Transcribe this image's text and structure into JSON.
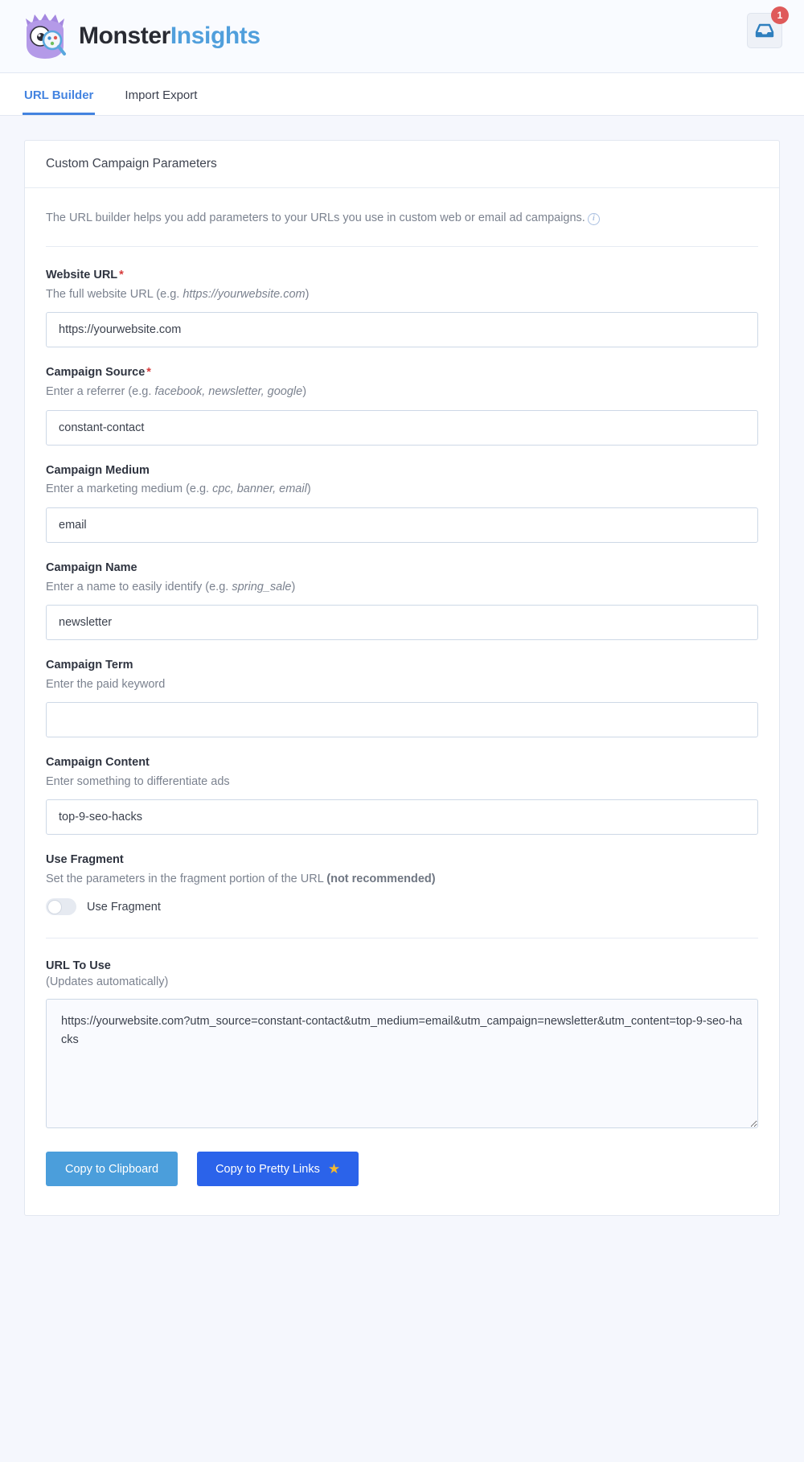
{
  "header": {
    "brand_first": "Monster",
    "brand_second": "Insights",
    "logo_icon": "monster-logo-icon",
    "inbox_icon": "inbox-tray-icon",
    "inbox_badge_count": "1"
  },
  "tabs": [
    {
      "label": "URL Builder",
      "active": true
    },
    {
      "label": "Import Export",
      "active": false
    }
  ],
  "card": {
    "title": "Custom Campaign Parameters",
    "intro": "The URL builder helps you add parameters to your URLs you use in custom web or email ad campaigns.",
    "info_icon": "info-circle-icon",
    "info_glyph": "i"
  },
  "fields": [
    {
      "label": "Website URL",
      "required": true,
      "required_mark": "*",
      "help_prefix": "The full website URL (e.g. ",
      "help_em": "https://yourwebsite.com",
      "help_suffix": ")",
      "value": "https://yourwebsite.com",
      "placeholder": ""
    },
    {
      "label": "Campaign Source",
      "required": true,
      "required_mark": "*",
      "help_prefix": "Enter a referrer (e.g. ",
      "help_em": "facebook, newsletter, google",
      "help_suffix": ")",
      "value": "constant-contact",
      "placeholder": ""
    },
    {
      "label": "Campaign Medium",
      "required": false,
      "required_mark": "",
      "help_prefix": "Enter a marketing medium (e.g. ",
      "help_em": "cpc, banner, email",
      "help_suffix": ")",
      "value": "email",
      "placeholder": ""
    },
    {
      "label": "Campaign Name",
      "required": false,
      "required_mark": "",
      "help_prefix": "Enter a name to easily identify (e.g. ",
      "help_em": "spring_sale",
      "help_suffix": ")",
      "value": "newsletter",
      "placeholder": ""
    },
    {
      "label": "Campaign Term",
      "required": false,
      "required_mark": "",
      "help_prefix": "Enter the paid keyword",
      "help_em": "",
      "help_suffix": "",
      "value": "",
      "placeholder": ""
    },
    {
      "label": "Campaign Content",
      "required": false,
      "required_mark": "",
      "help_prefix": "Enter something to differentiate ads",
      "help_em": "",
      "help_suffix": "",
      "value": "top-9-seo-hacks",
      "placeholder": ""
    }
  ],
  "fragment": {
    "label": "Use Fragment",
    "help_prefix": "Set the parameters in the fragment portion of the URL ",
    "help_strong": "(not recommended)",
    "toggle_label": "Use Fragment",
    "toggle_on": false
  },
  "url_output": {
    "title": "URL To Use",
    "subtitle": "(Updates automatically)",
    "value": "https://yourwebsite.com?utm_source=constant-contact&utm_medium=email&utm_campaign=newsletter&utm_content=top-9-seo-hacks"
  },
  "buttons": {
    "clipboard": "Copy to Clipboard",
    "pretty_links": "Copy to Pretty Links",
    "star_icon": "star-icon",
    "star_glyph": "★"
  },
  "colors": {
    "accent_blue": "#4383e0",
    "brand_blue": "#509fdc",
    "btn_clipboard": "#4b9edb",
    "btn_pretty": "#2b63ea",
    "required_red": "#d63b3b",
    "badge_red": "#df5a5a",
    "star_gold": "#f4b92f",
    "page_bg": "#f5f7fd"
  }
}
